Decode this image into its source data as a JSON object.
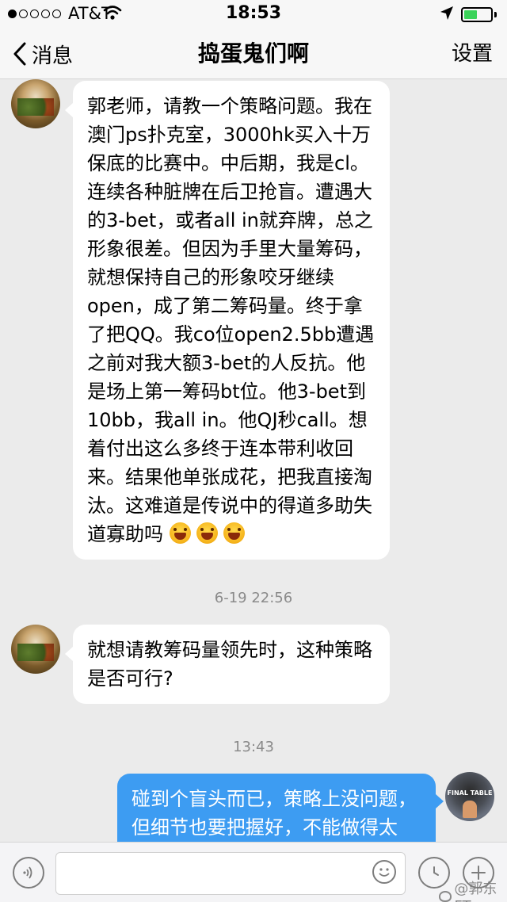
{
  "status_bar": {
    "carrier": "AT&T",
    "time": "18:53",
    "signal_bars_filled": 1,
    "signal_bars_total": 5,
    "battery_level": 0.5
  },
  "nav": {
    "back_label": "消息",
    "title": "捣蛋鬼们啊",
    "right_label": "设置"
  },
  "messages": {
    "msg1": {
      "lines": [
        "郭老师，请教一个策略问题。我在",
        "澳门ps扑克室，3000hk买入十万",
        "保底的比赛中。中后期，我是cl。",
        "连续各种脏牌在后卫抢盲。遭遇大",
        "的3-bet，或者all in就弃牌，总之",
        "形象很差。但因为手里大量筹码，",
        "就想保持自己的形象咬牙继续",
        "open，成了第二筹码量。终于拿",
        "了把QQ。我co位open2.5bb遭遇",
        "之前对我大额3-bet的人反抗。他",
        "是场上第一筹码bt位。他3-bet到",
        "10bb，我all in。他QJ秒call。想",
        "着付出这么多终于连本带利收回",
        "来。结果他单张成花，把我直接淘",
        "汰。这难道是传说中的得道多助失"
      ],
      "last_line": "道寡助吗",
      "emoji": "grinning-face-emoji"
    },
    "ts1": "6-19 22:56",
    "msg2": {
      "lines": [
        "就想请教筹码量领先时，这种策略",
        "是否可行?"
      ]
    },
    "ts2": "13:43",
    "msg3": {
      "lines": [
        "碰到个盲头而已，策略上没问题，",
        "但细节也要把握好，不能做得太"
      ]
    }
  },
  "watermark": "@郭东FT",
  "colors": {
    "outgoing_bubble": "#3d9cf2",
    "incoming_bubble": "#ffffff",
    "background": "#ebebeb",
    "battery": "#3bd35a"
  },
  "icons": [
    "back-chevron-icon",
    "voice-icon",
    "emoji-icon",
    "clock-icon",
    "plus-icon",
    "wifi-icon",
    "location-arrow-icon",
    "weibo-logo-icon"
  ]
}
